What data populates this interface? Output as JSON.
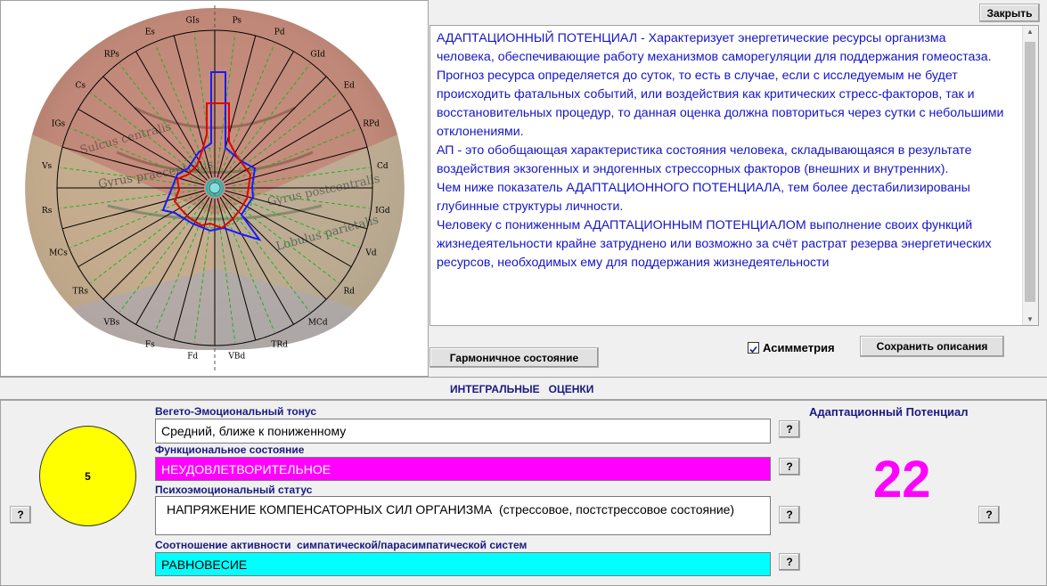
{
  "radar": {
    "sectors": [
      "Ps",
      "Pd",
      "GId",
      "Ed",
      "RPd",
      "Cd",
      "IGd",
      "Vd",
      "Rd",
      "MCd",
      "TRd",
      "VBd",
      "Fd",
      "Fs",
      "VBs",
      "TRs",
      "MCs",
      "Rs",
      "Vs",
      "IGs",
      "Cs",
      "RPs",
      "Es",
      "GIs"
    ]
  },
  "brain_labels": {
    "l1": "Sulcus centralis",
    "l2": "Gyrus praecentralis",
    "l3": "Gyrus postcentralis",
    "l4": "Lobulus parietalis"
  },
  "toolbar": {
    "close_label": "Закрыть"
  },
  "description": {
    "paragraphs": [
      "АДАПТАЦИОННЫЙ ПОТЕНЦИАЛ -  Характеризует энергетические ресурсы организма человека, обеспечивающие работу механизмов саморегуляции для поддержания гомеостаза.",
      "   Прогноз ресурса определяется до суток, то есть в случае, если с исследуемым не будет происходить фатальных событий,  или воздействия как критических стресс-факторов, так и восстановительных процедур, то данная оценка должна повториться через сутки с небольшими отклонениями.",
      "   АП - это обобщающая характеристика состояния человека, складывающаяся в результате воздействия экзогенных и эндогенных стрессорных факторов (внешних и внутренних).",
      "   Чем ниже показатель АДАПТАЦИОННОГО ПОТЕНЦИАЛА, тем более дестабилизированы глубинные структуры личности.",
      "   Человеку с пониженным АДАПТАЦИОННЫМ ПОТЕНЦИАЛОМ выполнение своих функций жизнедеятельности крайне затруднено или возможно за счёт растрат резерва энергетических ресурсов, необходимых ему для поддержания жизнедеятельности"
    ]
  },
  "controls": {
    "asymmetry_label": "Асимметрия",
    "asymmetry_checked": true,
    "save_label": "Сохранить описания",
    "harmonic_label": "Гармоничное состояние"
  },
  "integral": {
    "title": "ИНТЕГРАЛЬНЫЕ   ОЦЕНКИ",
    "circle_value": "5",
    "help_label": "?",
    "tonus_label": "Вегето-Эмоциональный тонус",
    "tonus_value": "Средний, ближе к пониженному",
    "func_label": "Функциональное состояние",
    "func_value": "НЕУДОВЛЕТВОРИТЕЛЬНОЕ",
    "psy_label": "Психоэмоциональный статус",
    "psy_value": "НАПРЯЖЕНИЕ КОМПЕНСАТОРНЫХ СИЛ ОРГАНИЗМА  (стрессовое, постстрессовое состояние)",
    "balance_label": "Соотношение активности  симпатической/парасимпатической систем",
    "balance_value": "РАВНОВЕСИЕ",
    "ap_label": "Адаптационный Потенциал",
    "ap_value": "22"
  },
  "colors": {
    "desc_text": "#1515c8",
    "func_bg": "#ff00ff",
    "balance_bg": "#00ffff",
    "circle_fill": "#ffff00",
    "ap_value": "#ff00ff"
  }
}
